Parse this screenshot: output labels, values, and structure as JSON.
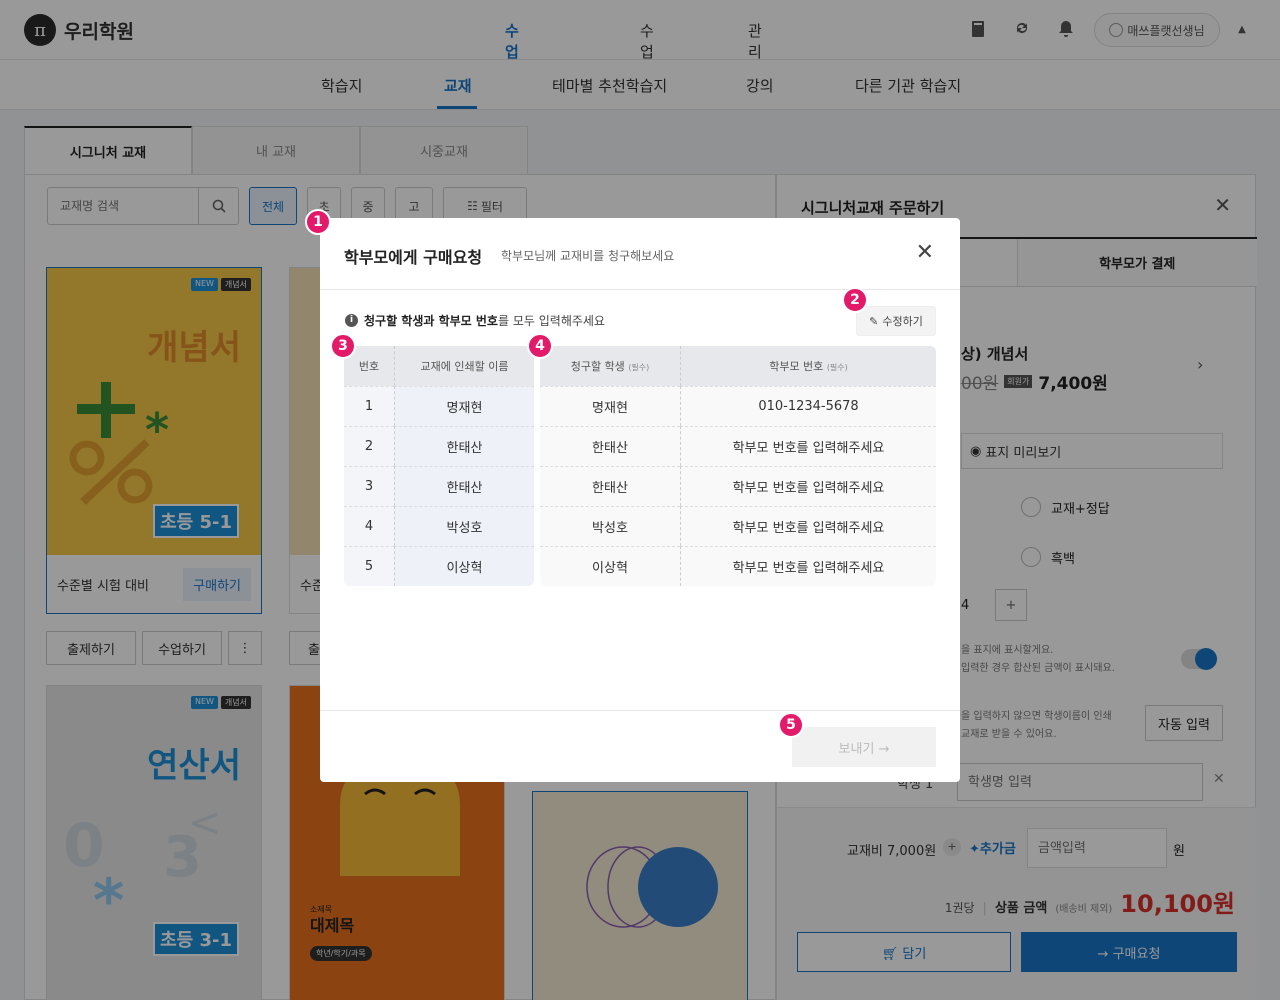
{
  "app": {
    "logo_mark": "π",
    "logo_text": "우리학원"
  },
  "main_nav": [
    "수업준비",
    "수업",
    "관리"
  ],
  "user": {
    "name": "매쓰플랫선생님"
  },
  "sub_nav": [
    "학습지",
    "교재",
    "테마별 추천학습지",
    "강의",
    "다른 기관 학습지"
  ],
  "book_tabs": [
    "시그니처 교재",
    "내 교재",
    "시중교재"
  ],
  "filters": {
    "search_placeholder": "교재명 검색",
    "chips": [
      "전체",
      "초",
      "중",
      "고"
    ],
    "filter_label": "필터"
  },
  "cards": [
    {
      "badge_new": "NEW",
      "badge_cat": "개념서",
      "title": "개념서",
      "grade": "초등 5-1",
      "label": "수준별 시험 대비",
      "buy": "구매하기"
    },
    {
      "label": "수준"
    },
    {
      "badge_new": "NEW",
      "badge_cat": "개념서",
      "title": "연산서",
      "grade": "초등 3-1"
    },
    {
      "small": "소제목",
      "title": "대제목",
      "tag": "학년/학기/과목"
    }
  ],
  "card_actions": {
    "create": "출제하기",
    "lesson": "수업하기",
    "more": "⋮",
    "partial": "출"
  },
  "right_panel": {
    "title": "시그니처교재 주문하기",
    "tab_parent": "학부모가 결제",
    "book_name": "상) 개념서",
    "price_old": "00원",
    "price_label": "회원가",
    "price": "7,400원",
    "preview": "표지 미리보기",
    "opt1": "교재+정답",
    "opt2": "흑백",
    "qty": "4",
    "note1": "을 표지에 표시할게요.",
    "note2": "입력한 경우 합산된 금액이 표시돼요.",
    "note3": "을 입력하지 않으면 학생이름이 인쇄",
    "note4": "교재로 받을 수 있어요.",
    "auto_input": "자동 입력",
    "student_label": "학생 1",
    "student_placeholder": "학생명 입력",
    "book_fee": "교재비 7,000원",
    "extra_label": "추가금",
    "extra_placeholder": "금액입력",
    "won": "원",
    "per_book": "1권당",
    "product_label": "상품 금액",
    "shipping": "(배송비 제외)",
    "total": "10,100원",
    "cart": "담기",
    "order": "구매요청"
  },
  "modal": {
    "title": "학부모에게 구매요청",
    "subtitle": "학부모님께 교재비를 청구해보세요",
    "info_bold": "청구할 학생과 학부모 번호",
    "info_rest": "를 모두 입력해주세요",
    "edit": "수정하기",
    "headers": {
      "no": "번호",
      "print": "교재에 인쇄할 이름",
      "student": "청구할 학생",
      "student_req": "(필수)",
      "phone": "학부모 번호",
      "phone_req": "(필수)"
    },
    "rows": [
      {
        "no": "1",
        "print": "명재현",
        "student": "명재현",
        "phone": "010-1234-5678",
        "missing": false
      },
      {
        "no": "2",
        "print": "한태산",
        "student": "한태산",
        "phone": "학부모 번호를 입력해주세요",
        "missing": true
      },
      {
        "no": "3",
        "print": "한태산",
        "student": "한태산",
        "phone": "학부모 번호를 입력해주세요",
        "missing": true
      },
      {
        "no": "4",
        "print": "박성호",
        "student": "박성호",
        "phone": "학부모 번호를 입력해주세요",
        "missing": true
      },
      {
        "no": "5",
        "print": "이상혁",
        "student": "이상혁",
        "phone": "학부모 번호를 입력해주세요",
        "missing": true
      }
    ],
    "send": "보내기"
  },
  "markers": [
    "1",
    "2",
    "3",
    "4",
    "5"
  ],
  "colors": {
    "accent": "#1976c9",
    "marker": "#e3196a",
    "warning": "#e54848"
  }
}
